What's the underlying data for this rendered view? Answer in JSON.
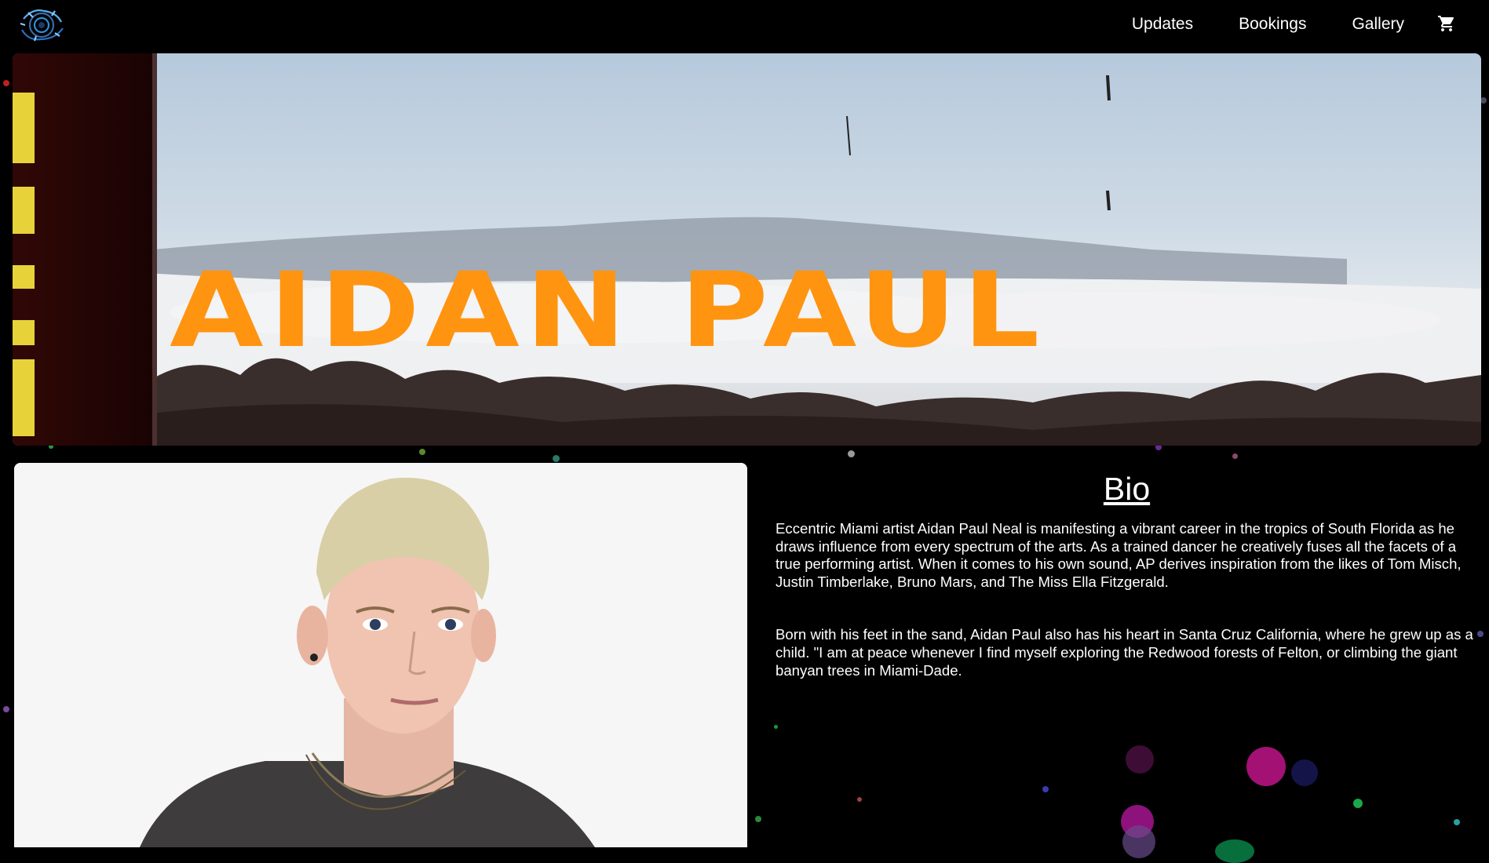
{
  "nav": {
    "logo_icon": "swirl-logo-icon",
    "links": [
      "Updates",
      "Bookings",
      "Gallery"
    ],
    "cart_icon": "shopping-cart-icon"
  },
  "hero": {
    "title": "AIDAN PAUL",
    "title_color": "#ff9410"
  },
  "portrait": {
    "icon": "artist-portrait-photo"
  },
  "bio": {
    "title": "Bio",
    "paragraphs": [
      "Eccentric Miami artist Aidan Paul Neal is manifesting a vibrant career in the tropics of South Florida as he draws influence from every spectrum of the arts. As a trained dancer he creatively fuses all the facets of a true performing artist. When it comes to his own sound, AP derives inspiration from the likes of Tom Misch, Justin Timberlake, Bruno Mars, and The Miss Ella Fitzgerald.",
      "Born with his feet in the sand, Aidan Paul also has his heart in Santa Cruz California, where he grew up as a child. \"I am at peace whenever I find myself exploring the Redwood forests of Felton, or climbing the giant banyan trees in Miami-Dade."
    ]
  },
  "colors": {
    "background": "#000000",
    "accent": "#ff9410",
    "text": "#ffffff"
  }
}
